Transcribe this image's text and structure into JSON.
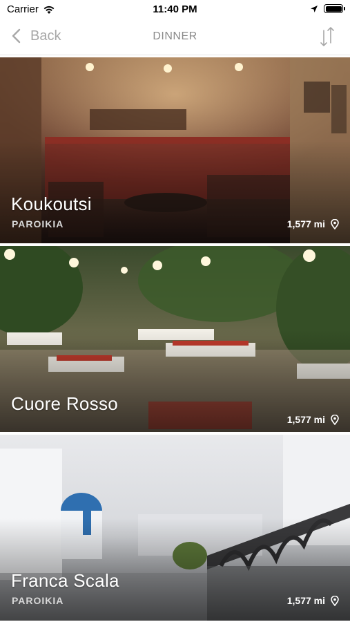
{
  "status_bar": {
    "carrier": "Carrier",
    "time": "11:40 PM",
    "icons": [
      "wifi-icon",
      "location-arrow-icon",
      "battery-icon"
    ]
  },
  "nav": {
    "back_label": "Back",
    "title": "DINNER",
    "icons": [
      "chevron-left-icon",
      "sort-icon"
    ]
  },
  "restaurants": [
    {
      "name": "Koukoutsi",
      "area": "PAROIKIA",
      "distance": "1,577 mi"
    },
    {
      "name": "Cuore Rosso",
      "area": "",
      "distance": "1,577 mi"
    },
    {
      "name": "Franca Scala",
      "area": "PAROIKIA",
      "distance": "1,577 mi"
    }
  ],
  "colors": {
    "nav_text": "#a7a7a7",
    "title_text": "#8a8a8a",
    "card_text": "#ffffff"
  }
}
